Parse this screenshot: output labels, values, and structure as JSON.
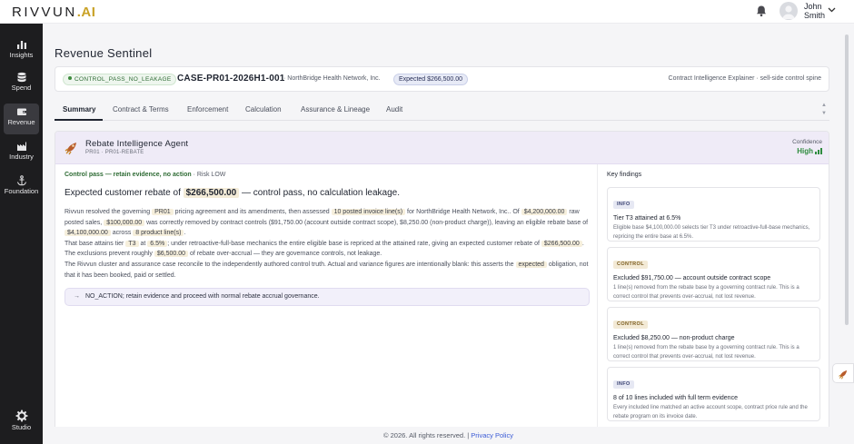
{
  "brand": {
    "name_main": "RIVVUN",
    "name_dot": ".",
    "name_ai": "AI"
  },
  "user": {
    "first_name": "John",
    "last_name": "Smith"
  },
  "sidebar": {
    "items": [
      {
        "label": "Insights",
        "icon": "bar-chart-icon"
      },
      {
        "label": "Spend",
        "icon": "database-icon"
      },
      {
        "label": "Revenue",
        "icon": "wallet-icon",
        "active": true
      },
      {
        "label": "Industry",
        "icon": "factory-icon"
      },
      {
        "label": "Foundation",
        "icon": "anchor-icon"
      }
    ],
    "studio_label": "Studio"
  },
  "page": {
    "title": "Revenue Sentinel"
  },
  "case": {
    "status_badge": "CONTROL_PASS_NO_LEAKAGE",
    "id": "CASE-PR01-2026H1-001",
    "org": "· NorthBridge Health Network, Inc.",
    "expected_badge": "Expected $266,500.00",
    "right_text": "Contract Intelligence Explainer · sell-side control spine"
  },
  "tabs": [
    {
      "label": "Summary",
      "active": true
    },
    {
      "label": "Contract & Terms"
    },
    {
      "label": "Enforcement"
    },
    {
      "label": "Calculation"
    },
    {
      "label": "Assurance & Lineage"
    },
    {
      "label": "Audit"
    }
  ],
  "agent": {
    "name": "Rebate Intelligence Agent",
    "sub": "PR01 · PR01-REBATE",
    "confidence_label": "Confidence",
    "confidence_value": "High"
  },
  "summary": {
    "status_ok": "Control pass — retain evidence, no action",
    "status_risk": " · Risk LOW",
    "headline_pre": "Expected customer rebate of ",
    "headline_amount": "$266,500.00",
    "headline_post": " — control pass, no calculation leakage.",
    "p1": {
      "t1": "Rivvun resolved the governing ",
      "c1": "PR01",
      "t2": " pricing agreement and its amendments, then assessed ",
      "c2": "10 posted invoice line(s)",
      "t3": " for NorthBridge Health Network, Inc.. Of ",
      "c3": "$4,200,000.00",
      "t4": " raw posted sales, ",
      "c4": "$100,000.00",
      "t5": " was correctly removed by contract controls ($91,750.00 (account outside contract scope), $8,250.00 (non-product charge)), leaving an eligible rebate base of ",
      "c5": "$4,100,000.00",
      "t6": " across ",
      "c6": "8 product line(s)",
      "t7": "."
    },
    "p2": {
      "t1": "That base attains tier ",
      "c1": "T3",
      "t2": " at ",
      "c2": "6.5%",
      "t3": "; under retroactive-full-base mechanics the entire eligible base is repriced at the attained rate, giving an expected customer rebate of ",
      "c3": "$266,500.00",
      "t4": ". The exclusions prevent roughly ",
      "c4": "$6,500.00",
      "t5": " of rebate over-accrual — they are governance controls, not leakage."
    },
    "p3": {
      "t1": "The Rivvun cluster and assurance case reconcile to the independently authored control truth. Actual and variance figures are intentionally blank: this asserts the ",
      "c1": "expected",
      "t2": " obligation, not that it has been booked, paid or settled."
    },
    "action": "NO_ACTION; retain evidence and proceed with normal rebate accrual governance."
  },
  "key_findings": {
    "title": "Key findings",
    "items": [
      {
        "tag": "INFO",
        "kind": "info",
        "title": "Tier T3 attained at 6.5%",
        "desc": "Eligible base $4,100,000.00 selects tier T3 under retroactive-full-base mechanics, repricing the entire base at 6.5%."
      },
      {
        "tag": "CONTROL",
        "kind": "control",
        "title": "Excluded $91,750.00 — account outside contract scope",
        "desc": "1 line(s) removed from the rebate base by a governing contract rule. This is a correct control that prevents over-accrual, not lost revenue."
      },
      {
        "tag": "CONTROL",
        "kind": "control",
        "title": "Excluded $8,250.00 — non-product charge",
        "desc": "1 line(s) removed from the rebate base by a governing contract rule. This is a correct control that prevents over-accrual, not lost revenue."
      },
      {
        "tag": "INFO",
        "kind": "info",
        "title": "8 of 10 lines included with full term evidence",
        "desc": "Every included line matched an active account scope, contract price rule and the rebate program on its invoice date."
      }
    ]
  },
  "footer": {
    "copyright": "© 2026. All rights reserved. | ",
    "privacy": "Privacy Policy"
  },
  "colors": {
    "accent_gold": "#c9a227",
    "sidebar_bg": "#1d1d1f",
    "pass_green": "#2e8b3e",
    "agent_header": "#efebf7"
  }
}
